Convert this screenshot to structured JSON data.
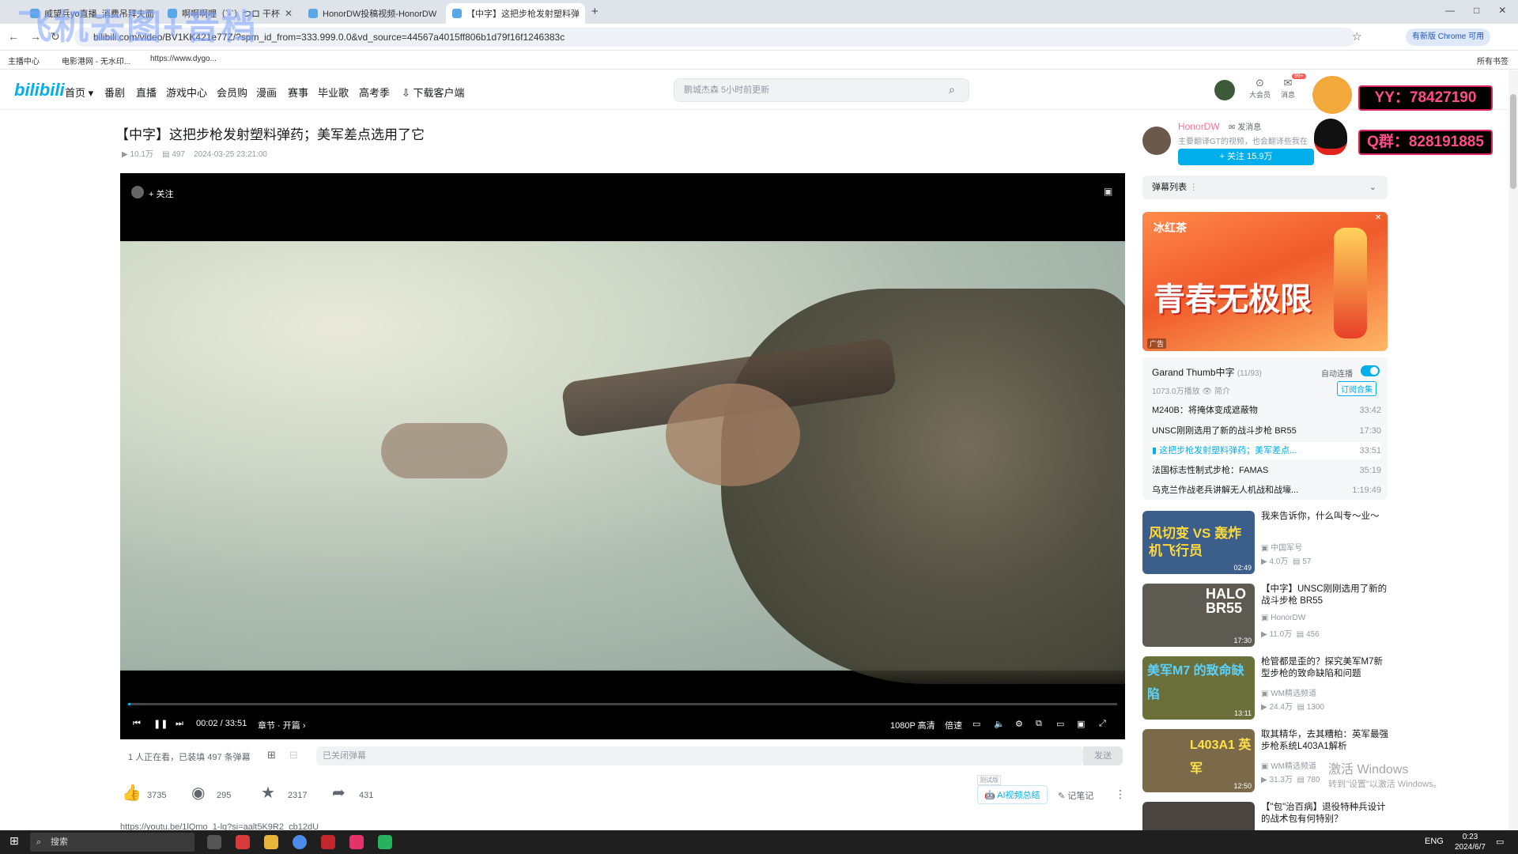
{
  "watermark_overlay": "飞机去图+音档",
  "browser": {
    "tabs": [
      {
        "label": "威望兵yo直播_消费吊拜夫面",
        "active": false
      },
      {
        "label": "啊啊啊哩（`-`）つロ 干杯",
        "active": false
      },
      {
        "label": "HonorDW投稿视频-HonorDW",
        "active": false
      },
      {
        "label": "【中字】这把步枪发射塑料弹",
        "active": true
      }
    ],
    "new_tab": "+",
    "url": "bilibili.com/video/BV1KK421e77Z/?spm_id_from=333.999.0.0&vd_source=44567a4015ff806b1d79f16f1246383c",
    "chrome_update": "有新版 Chrome 可用",
    "bookmarks": [
      "主播中心",
      "电影港网 - 无水印...",
      "https://www.dygo..."
    ],
    "all_bookmarks": "所有书签"
  },
  "site_header": {
    "logo": "bilibili",
    "nav": [
      "首页",
      "番剧",
      "直播",
      "游戏中心",
      "会员购",
      "漫画",
      "赛事",
      "毕业歌",
      "高考季",
      "下载客户端"
    ],
    "search_placeholder": "鹏城杰森 5小时前更新",
    "user_items": [
      "大会员",
      "消息"
    ],
    "message_badge": "99+"
  },
  "video": {
    "title": "【中字】这把步枪发射塑料弹药；美军差点选用了它",
    "views": "10.1万",
    "danmaku_count": "497",
    "date": "2024-03-25 23:21:00",
    "follow_label": "+ 关注",
    "time_current": "00:02",
    "time_total": "33:51",
    "time_display": "00:02 / 33:51",
    "chapter": "章节 · 开篇",
    "quality": "1080P 高清",
    "speed": "倍速",
    "progress_fraction": 0.001
  },
  "danmaku_bar": {
    "watching": "1 人正在看，已装填 497 条弹幕",
    "input_placeholder": "已关闭弹幕",
    "send": "发送"
  },
  "actions": {
    "like": "3735",
    "coin": "295",
    "favorite": "2317",
    "share": "431",
    "ai_summary": "AI视频总结",
    "ai_badge": "测试版",
    "notes": "记笔记"
  },
  "description_link": "https://youtu.be/1lQmo_1-lg?si=aalt5K9R2_cb12dU",
  "up": {
    "name": "HonorDW",
    "message": "发消息",
    "desc": "主要翻译GT的视频，也会翻译些我在",
    "follow": "+ 关注 15.9万"
  },
  "danmaku_list_label": "弹幕列表",
  "ad": {
    "brand": "冰红茶",
    "slogan": "青春无极限",
    "badge": "广告"
  },
  "playlist": {
    "title": "Garand Thumb中字",
    "count": "(11/93)",
    "autoplay": "自动连播",
    "plays": "1073.0万播放",
    "intro": "简介",
    "subscribe": "订阅合集",
    "items": [
      {
        "title": "M240B：将掩体变成遮蔽物",
        "duration": "33:42",
        "current": false
      },
      {
        "title": "UNSC刚刚选用了新的战斗步枪 BR55",
        "duration": "17:30",
        "current": false
      },
      {
        "title": "这把步枪发射塑料弹药；美军差点...",
        "duration": "33:51",
        "current": true
      },
      {
        "title": "法国标志性制式步枪：FAMAS",
        "duration": "35:19",
        "current": false
      },
      {
        "title": "乌克兰作战老兵讲解无人机战和战壕...",
        "duration": "1:19:49",
        "current": false
      }
    ]
  },
  "recommendations": [
    {
      "title": "我来告诉你，什么叫专～业～",
      "author": "中国军号",
      "views": "4.0万",
      "danmaku": "57",
      "duration": "02:49",
      "thumb_text": "风切变 VS 轰炸机飞行员",
      "color": "#3b5f8a"
    },
    {
      "title": "【中字】UNSC刚刚选用了新的战斗步枪 BR55",
      "author": "HonorDW",
      "views": "11.0万",
      "danmaku": "456",
      "duration": "17:30",
      "thumb_text": "HALO BR55",
      "color": "#5d5a52"
    },
    {
      "title": "枪管都是歪的？探究美军M7新型步枪的致命缺陷和问题",
      "author": "WM精选频道",
      "views": "24.4万",
      "danmaku": "1300",
      "duration": "13:11",
      "thumb_text": "美军M7 的致命缺陷",
      "color": "#6b6f3a"
    },
    {
      "title": "取其精华，去其糟粕：英军最强步枪系统L403A1解析",
      "author": "WM精选频道",
      "views": "31.3万",
      "danmaku": "780",
      "duration": "12:50",
      "thumb_text": "L403A1 英军",
      "color": "#7a6a4a"
    },
    {
      "title": "【\"包\"治百病】退役特种兵设计的战术包有何特别？",
      "author": "",
      "views": "",
      "danmaku": "",
      "duration": "",
      "thumb_text": "",
      "color": "#4a4440"
    }
  ],
  "windows_watermark": {
    "line1": "激活 Windows",
    "line2": "转到\"设置\"以激活 Windows。"
  },
  "promo": {
    "line1": "YY：78427190",
    "line2": "Q群：828191885"
  },
  "taskbar": {
    "search": "搜索",
    "lang": "ENG",
    "time": "0:23",
    "date": "2024/6/7"
  },
  "colors": {
    "bili_blue": "#00aeec",
    "bili_pink": "#fb7299"
  }
}
